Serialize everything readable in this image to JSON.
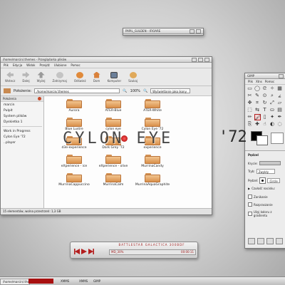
{
  "overlay_text": {
    "left": "CYLON EYE",
    "right": "'72"
  },
  "small_window": {
    "title": "PAPIL_GULDEN - IFIOARE"
  },
  "file_manager": {
    "title": "/home/marcin/.themes - Przeglądarka plików",
    "menus": [
      "Plik",
      "Edycja",
      "Widok",
      "Przejdź",
      "Ulubione",
      "Pomoc"
    ],
    "toolbar": [
      "Wstecz",
      "Dalej",
      "Wyżej",
      "Zatrzymaj",
      "Odśwież",
      "Dom",
      "Komputer",
      "Szukaj"
    ],
    "location_label": "Położenie:",
    "location_value": "/home/marcin/.themes",
    "zoom": "100%",
    "view_mode": "Wyświetlanie jako ikony",
    "sidebar_title": "Położenia",
    "sidebar_items": [
      "marcin",
      "Pulpit",
      "System plików",
      "Dyskietka 1"
    ],
    "sidebar_items2": [
      "Work in Progress",
      "Cylon Eye '72",
      "..player"
    ],
    "folders": [
      "Aurora",
      "ATER-Blue",
      "ATER-White",
      "Blue Lustre",
      "cylon eye",
      "Cylon Eye '72",
      "d3e-experience",
      "Dark Grey '72",
      "experience",
      "eXperience - ice",
      "eXperience - olive",
      "MurrinaCandy",
      "MurrinaCappuccino",
      "MurrinaCalm",
      "MurrinaAquaGraphite"
    ],
    "status": "15 elementów, wolna przestrzeń: 1,3 GB"
  },
  "gimp": {
    "title": "GIMP",
    "menus": [
      "Plik",
      "Xtns",
      "Pomoc"
    ],
    "options_title": "Pędzel",
    "mode_label": "Tryb:",
    "mode_value": "Zwykły",
    "opacity_label": "Krycie:",
    "brush_label": "Pędzel:",
    "brush_value": "Circle (11)",
    "checks": [
      "Czułość nacisku:",
      "Zanikanie",
      "Rozpraszanie",
      "Użyj koloru z gradientu"
    ]
  },
  "player": {
    "display": "BATTLESTAR GALACTICA 300BDF",
    "time_left": "MD_30%",
    "time_right": "00:00:11"
  },
  "taskbar": {
    "items": [
      "/home/marcin/.themes - Pr...",
      "XMMS",
      "XMMS",
      "GIMP"
    ]
  },
  "colors": {
    "accent": "#b31e1e",
    "folder": "#e2a25f"
  }
}
